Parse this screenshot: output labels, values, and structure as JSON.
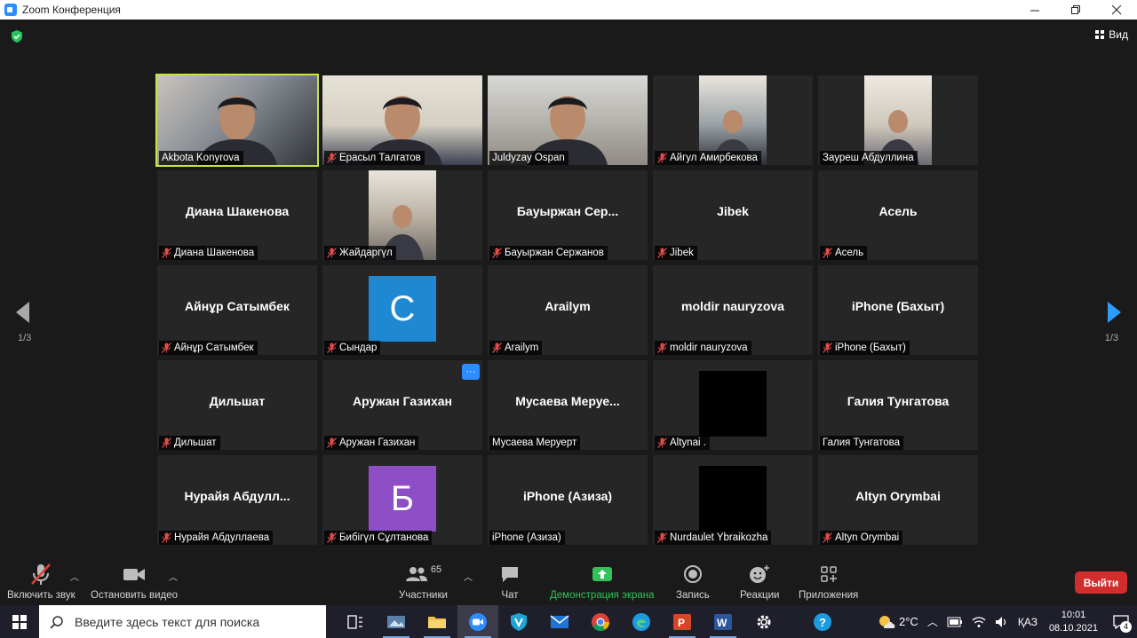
{
  "window": {
    "title": "Zoom Конференция",
    "controls": [
      "minimize",
      "restore",
      "close"
    ]
  },
  "meeting": {
    "view_label": "Вид",
    "page_left": "1/3",
    "page_right": "1/3",
    "participants": [
      {
        "name": "Akbota Konyrova",
        "big_name": "",
        "muted": false,
        "type": "video",
        "active_speaker": true
      },
      {
        "name": "Ерасыл Талгатов",
        "big_name": "",
        "muted": true,
        "type": "video"
      },
      {
        "name": "Juldyzay Ospan",
        "big_name": "",
        "muted": false,
        "type": "video"
      },
      {
        "name": "Айгул Амирбекова",
        "big_name": "",
        "muted": true,
        "type": "video-small"
      },
      {
        "name": "Заурешь Абдуллина",
        "display": "Зауреш Абдуллина",
        "big_name": "",
        "muted": false,
        "type": "video-small"
      },
      {
        "name": "Диана Шакенова",
        "big_name": "Диана Шакенова",
        "muted": true,
        "type": "name"
      },
      {
        "name": "Жайдаргүл",
        "big_name": "",
        "muted": true,
        "type": "video-small"
      },
      {
        "name": "Бауыржан Сержанов",
        "big_name": "Бауыржан  Сер...",
        "muted": true,
        "type": "name"
      },
      {
        "name": "Jibek",
        "big_name": "Jibek",
        "muted": true,
        "type": "name"
      },
      {
        "name": "Асель",
        "big_name": "Асель",
        "muted": true,
        "type": "name"
      },
      {
        "name": "Айнұр Сатымбек",
        "big_name": "Айнұр Сатымбек",
        "muted": true,
        "type": "name"
      },
      {
        "name": "Сындар",
        "big_name": "",
        "muted": true,
        "type": "avatar",
        "avatar_letter": "С",
        "avatar_color": "#1e88d2"
      },
      {
        "name": "Arailym",
        "big_name": "Arailym",
        "muted": true,
        "type": "name"
      },
      {
        "name": "moldir nauryzova",
        "big_name": "moldir nauryzova",
        "muted": true,
        "type": "name"
      },
      {
        "name": "iPhone (Бахыт)",
        "big_name": "iPhone (Бахыт)",
        "muted": true,
        "type": "name"
      },
      {
        "name": "Дильшат",
        "big_name": "Дильшат",
        "muted": true,
        "type": "name"
      },
      {
        "name": "Аружан Газихан",
        "big_name": "Аружан Газихан",
        "muted": true,
        "type": "name",
        "more": true
      },
      {
        "name": "Мусаева Меруерт",
        "big_name": "Мусаева  Меруе...",
        "muted": false,
        "type": "name"
      },
      {
        "name": "Altynai .",
        "big_name": "",
        "muted": true,
        "type": "black"
      },
      {
        "name": "Галия Тунгатова",
        "big_name": "Галия Тунгатова",
        "muted": false,
        "type": "name"
      },
      {
        "name": "Нурайя Абдуллаева",
        "big_name": "Нурайя  Абдулл...",
        "muted": true,
        "type": "name"
      },
      {
        "name": "Бибігүл Сұлтанова",
        "big_name": "",
        "muted": true,
        "type": "avatar",
        "avatar_letter": "Б",
        "avatar_color": "#8e4ec6"
      },
      {
        "name": "iPhone (Азиза)",
        "big_name": "iPhone (Азиза)",
        "muted": false,
        "type": "name"
      },
      {
        "name": "Nurdaulet Ybraikozha",
        "big_name": "",
        "muted": true,
        "type": "black"
      },
      {
        "name": "Altyn Orymbai",
        "big_name": "Altyn Orymbai",
        "muted": true,
        "type": "name"
      }
    ]
  },
  "toolbar": {
    "unmute_label": "Включить звук",
    "stop_video_label": "Остановить видео",
    "participants_label": "Участники",
    "participants_count": "65",
    "chat_label": "Чат",
    "share_label": "Демонстрация экрана",
    "record_label": "Запись",
    "reactions_label": "Реакции",
    "apps_label": "Приложения",
    "leave_label": "Выйти",
    "colors": {
      "share": "#32c15a",
      "leave": "#d12d2d",
      "active_speaker": "#c8e34a",
      "more": "#2d8cff"
    }
  },
  "taskbar": {
    "search_placeholder": "Введите здесь текст для поиска",
    "temperature": "2°C",
    "language": "ҚАЗ",
    "time": "10:01",
    "date": "08.10.2021",
    "notifications": "4"
  }
}
